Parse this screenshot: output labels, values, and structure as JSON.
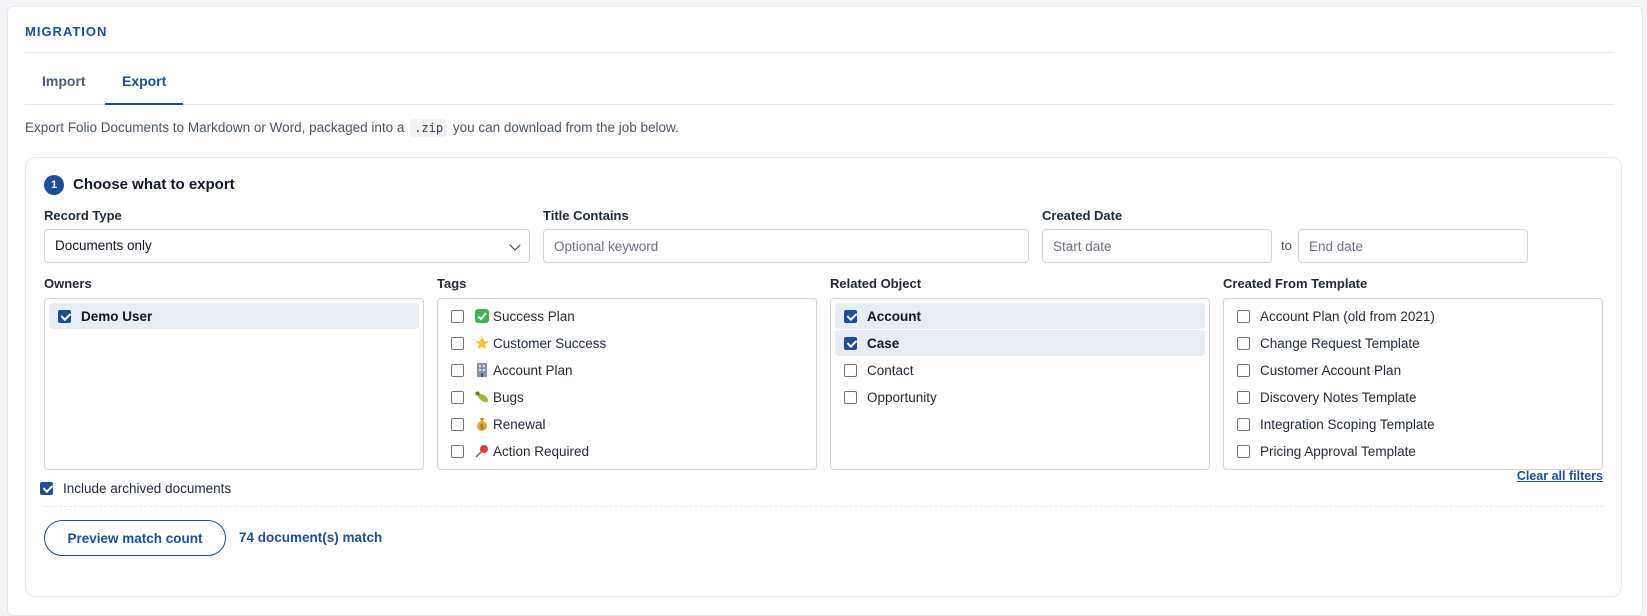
{
  "section_title": "MIGRATION",
  "tabs": [
    {
      "label": "Import",
      "active": false
    },
    {
      "label": "Export",
      "active": true
    }
  ],
  "intro": {
    "before": "Export Folio Documents to Markdown or Word, packaged into a",
    "code": ".zip",
    "after": "you can download from the job below."
  },
  "step": {
    "number": "1",
    "title": "Choose what to export"
  },
  "record_type": {
    "label": "Record Type",
    "value": "Documents only"
  },
  "title_contains": {
    "label": "Title Contains",
    "placeholder": "Optional keyword"
  },
  "created_date": {
    "label": "Created Date",
    "start_placeholder": "Start date",
    "to": "to",
    "end_placeholder": "End date"
  },
  "owners": {
    "label": "Owners",
    "items": [
      {
        "label": "Demo User",
        "checked": true
      }
    ]
  },
  "tags": {
    "label": "Tags",
    "items": [
      {
        "label": "Success Plan",
        "icon": "check-mark-icon",
        "checked": false
      },
      {
        "label": "Customer Success",
        "icon": "star-icon",
        "checked": false
      },
      {
        "label": "Account Plan",
        "icon": "office-building-icon",
        "checked": false
      },
      {
        "label": "Bugs",
        "icon": "bug-icon",
        "checked": false
      },
      {
        "label": "Renewal",
        "icon": "money-bag-icon",
        "checked": false
      },
      {
        "label": "Action Required",
        "icon": "pushpin-icon",
        "checked": false
      }
    ]
  },
  "related_object": {
    "label": "Related Object",
    "items": [
      {
        "label": "Account",
        "checked": true
      },
      {
        "label": "Case",
        "checked": true
      },
      {
        "label": "Contact",
        "checked": false
      },
      {
        "label": "Opportunity",
        "checked": false
      }
    ]
  },
  "template": {
    "label": "Created From Template",
    "items": [
      {
        "label": "Account Plan (old from 2021)",
        "checked": false
      },
      {
        "label": "Change Request Template",
        "checked": false
      },
      {
        "label": "Customer Account Plan",
        "checked": false
      },
      {
        "label": "Discovery Notes Template",
        "checked": false
      },
      {
        "label": "Integration Scoping Template",
        "checked": false
      },
      {
        "label": "Pricing Approval Template",
        "checked": false
      }
    ]
  },
  "include_archived": {
    "label": "Include archived documents",
    "checked": true
  },
  "clear_filters": "Clear all filters",
  "preview_button": "Preview match count",
  "match_count": "74 document(s) match",
  "colors": {
    "accent": "#1d4e9a",
    "selected_row": "#e8ecf3"
  }
}
